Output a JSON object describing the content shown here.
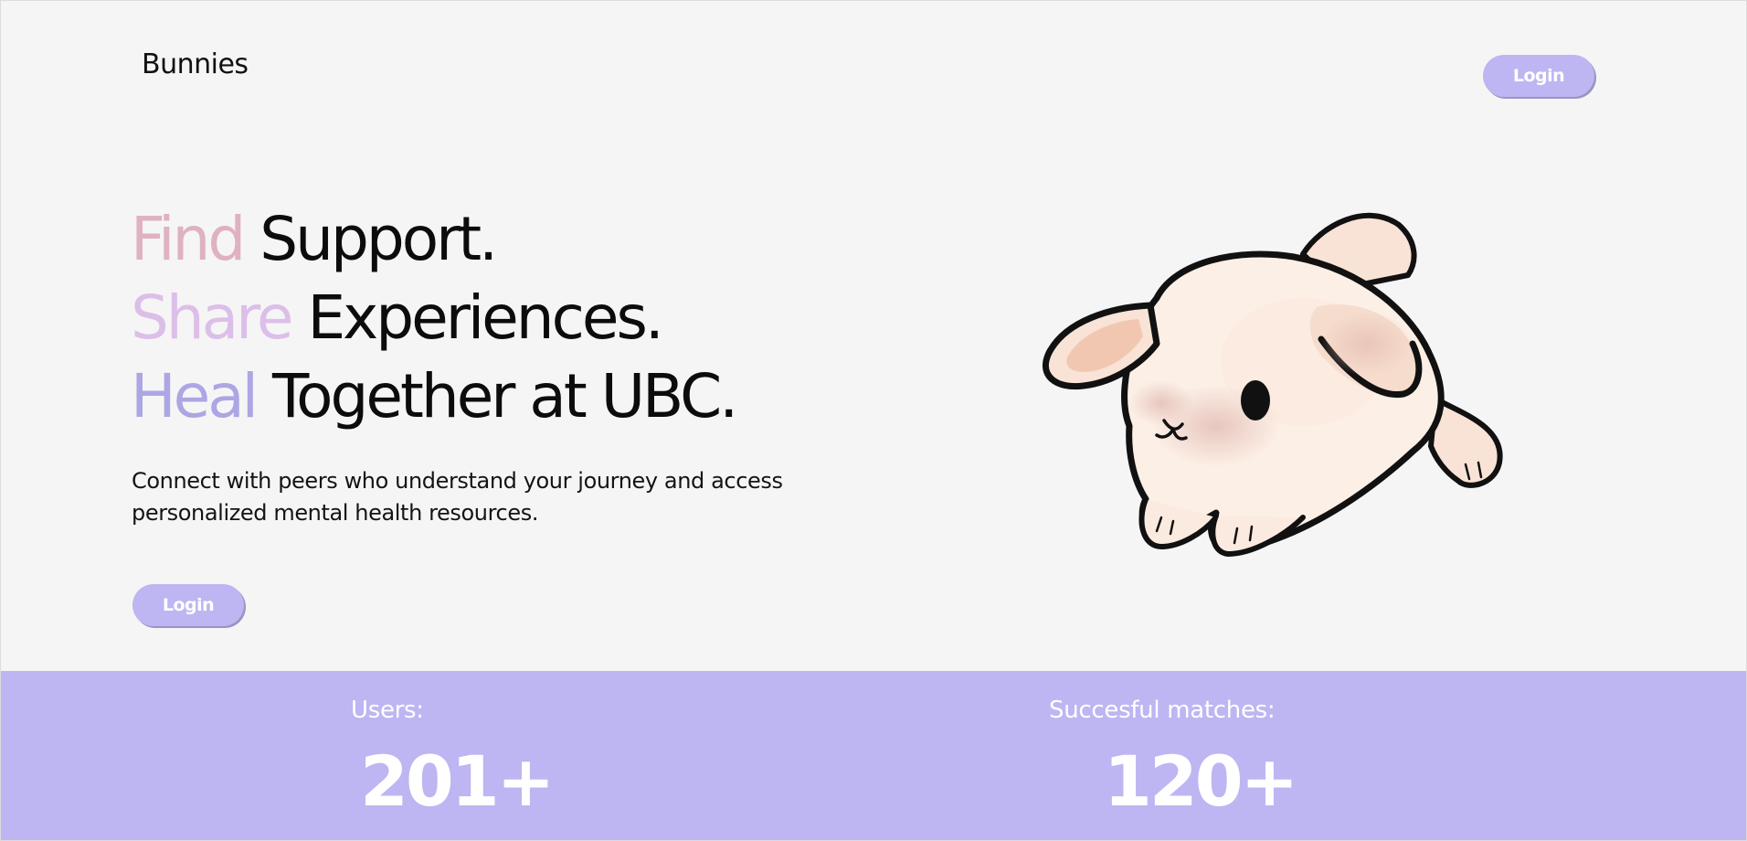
{
  "header": {
    "brand": "Bunnies",
    "login_label": "Login"
  },
  "hero": {
    "lines": [
      {
        "accent": "Find",
        "rest": "Support."
      },
      {
        "accent": "Share",
        "rest": "Experiences."
      },
      {
        "accent": "Heal",
        "rest": "Together at UBC."
      }
    ],
    "description": "Connect with peers who understand your journey and access personalized mental health resources.",
    "login_label": "Login"
  },
  "stats": {
    "users_label": "Users:",
    "users_value": "201+",
    "matches_label": "Succesful matches:",
    "matches_value": "120+"
  },
  "colors": {
    "accent_purple": "#bdb6f2",
    "find_pink": "#dfb1c1",
    "share_lilac": "#dcbfe9",
    "heal_periwinkle": "#aca6e4",
    "background": "#f5f5f5"
  },
  "illustration": {
    "icon": "bunny-illustration"
  }
}
